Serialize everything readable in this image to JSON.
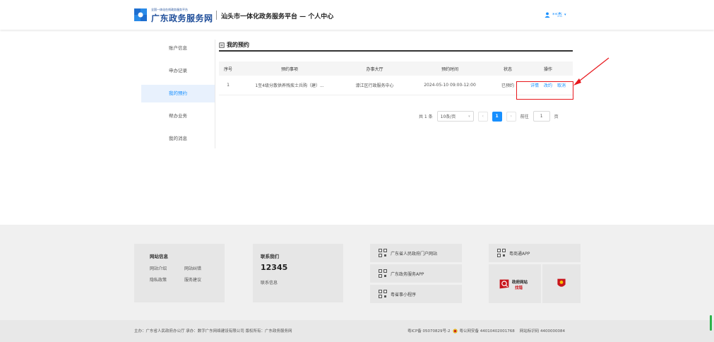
{
  "header": {
    "brand_small": "全国一体化在线政务服务平台",
    "brand_big": "广东政务服务网",
    "title": "汕头市一体化政务服务平台 — 个人中心",
    "user_name": "**杰"
  },
  "sidebar": {
    "items": [
      {
        "label": "账户信息"
      },
      {
        "label": "申办记录"
      },
      {
        "label": "我的预约"
      },
      {
        "label": "帮办业务"
      },
      {
        "label": "我的消息"
      }
    ]
  },
  "main": {
    "title": "我的预约",
    "columns": [
      "序号",
      "预约事项",
      "办事大厅",
      "预约时间",
      "状态",
      "操作"
    ],
    "rows": [
      {
        "index": "1",
        "item": "1至4级分散供养残疾士兵购（建）...",
        "hall": "濠江区行政服务中心",
        "time": "2024-05-10 09:00-12:00",
        "status": "已预约",
        "ops": [
          "详情",
          "改约",
          "取消"
        ]
      }
    ],
    "pagination": {
      "total": "共 1 条",
      "page_size": "10条/页",
      "current": "1",
      "goto_label": "前往",
      "goto_value": "1",
      "page_unit": "页"
    }
  },
  "footer": {
    "site_info": {
      "title": "网站信息",
      "links": [
        "网站介绍",
        "网站纠错",
        "隐私政策",
        "服务建议"
      ]
    },
    "contact": {
      "title": "联系我们",
      "number": "12345",
      "info": "联系信息"
    },
    "qr_links": [
      "广东省人民政府门户网站",
      "广东政务服务APP",
      "粤省事小程序"
    ],
    "qr_app": "粤商通APP",
    "gov_site_badge": [
      "政府网站",
      "找错"
    ],
    "bottom_left": "主办：广东省人民政府办公厅  承办：数字广东网络建设有限公司  版权所有：广东政务服务网",
    "icp": "粤ICP备 05070829号-2",
    "police": "粤公网安备 44010402001768",
    "site_code": "网站标识码 4400000084"
  },
  "colors": {
    "accent": "#1890ff",
    "brand": "#1f4e9a",
    "highlight": "#e8171c"
  }
}
